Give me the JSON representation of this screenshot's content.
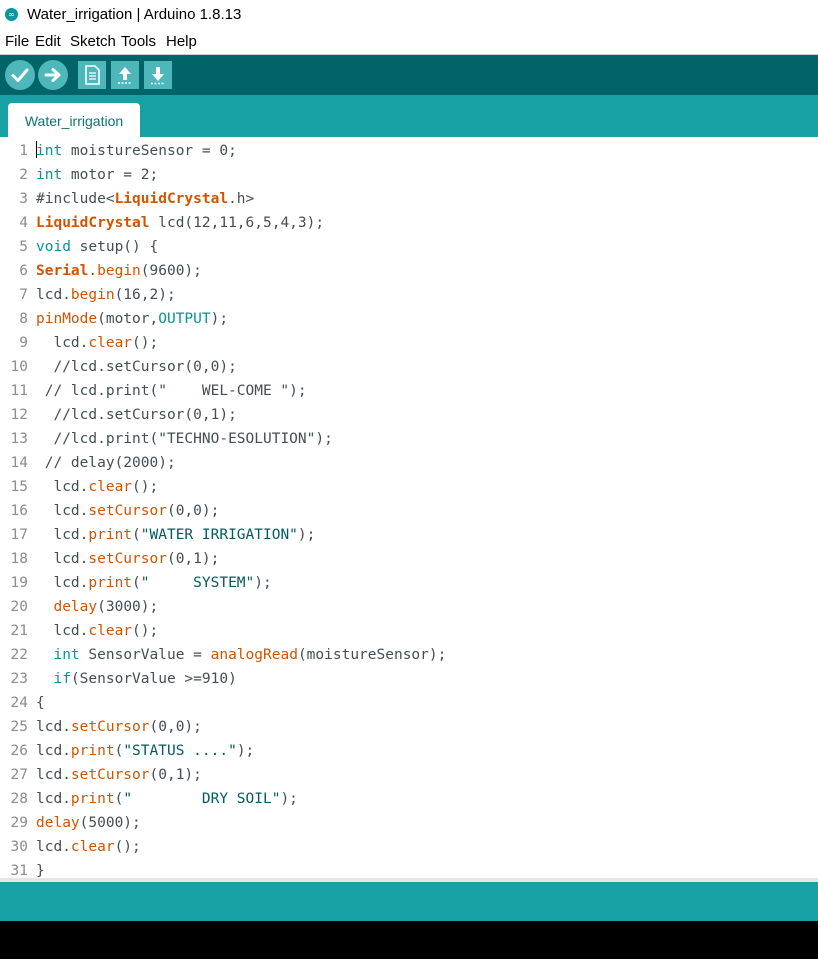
{
  "window": {
    "title": "Water_irrigation | Arduino 1.8.13",
    "app_icon": "arduino-logo-icon"
  },
  "menu": {
    "items": [
      "File",
      "Edit",
      "Sketch",
      "Tools",
      "Help"
    ]
  },
  "toolbar": {
    "buttons": [
      {
        "icon": "verify-check-icon"
      },
      {
        "icon": "upload-arrow-icon"
      },
      {
        "icon": "new-sketch-icon"
      },
      {
        "icon": "open-sketch-icon"
      },
      {
        "icon": "save-sketch-icon"
      }
    ]
  },
  "tabs": [
    {
      "label": "Water_irrigation",
      "active": true
    }
  ],
  "editor": {
    "lines": [
      {
        "n": "1",
        "code": "int moistureSensor = 0;"
      },
      {
        "n": "2",
        "code": "int motor = 2;"
      },
      {
        "n": "3",
        "code": "#include<LiquidCrystal.h>"
      },
      {
        "n": "4",
        "code": "LiquidCrystal lcd(12,11,6,5,4,3);"
      },
      {
        "n": "5",
        "code": "void setup() {"
      },
      {
        "n": "6",
        "code": "Serial.begin(9600);"
      },
      {
        "n": "7",
        "code": "lcd.begin(16,2);"
      },
      {
        "n": "8",
        "code": "pinMode(motor,OUTPUT);"
      },
      {
        "n": "9",
        "code": "  lcd.clear();"
      },
      {
        "n": "10",
        "code": "  //lcd.setCursor(0,0);"
      },
      {
        "n": "11",
        "code": " // lcd.print(\"    WEL-COME \");"
      },
      {
        "n": "12",
        "code": "  //lcd.setCursor(0,1);"
      },
      {
        "n": "13",
        "code": "  //lcd.print(\"TECHNO-ESOLUTION\");"
      },
      {
        "n": "14",
        "code": " // delay(2000);"
      },
      {
        "n": "15",
        "code": "  lcd.clear();"
      },
      {
        "n": "16",
        "code": "  lcd.setCursor(0,0);"
      },
      {
        "n": "17",
        "code": "  lcd.print(\"WATER IRRIGATION\");"
      },
      {
        "n": "18",
        "code": "  lcd.setCursor(0,1);"
      },
      {
        "n": "19",
        "code": "  lcd.print(\"     SYSTEM\");"
      },
      {
        "n": "20",
        "code": "  delay(3000);"
      },
      {
        "n": "21",
        "code": "  lcd.clear();"
      },
      {
        "n": "22",
        "code": "  int SensorValue = analogRead(moistureSensor);"
      },
      {
        "n": "23",
        "code": "  if(SensorValue >=910)"
      },
      {
        "n": "24",
        "code": "{"
      },
      {
        "n": "25",
        "code": "lcd.setCursor(0,0);"
      },
      {
        "n": "26",
        "code": "lcd.print(\"STATUS ....\");"
      },
      {
        "n": "27",
        "code": "lcd.setCursor(0,1);"
      },
      {
        "n": "28",
        "code": "lcd.print(\"        DRY SOIL\");"
      },
      {
        "n": "29",
        "code": "delay(5000);"
      },
      {
        "n": "30",
        "code": "lcd.clear();"
      },
      {
        "n": "31",
        "code": "}"
      }
    ]
  },
  "colors": {
    "toolbar": "#006468",
    "tabstrip": "#17a1a5",
    "keyword": "#00979c",
    "function": "#d35400",
    "string": "#005c5f",
    "text": "#434f54"
  }
}
